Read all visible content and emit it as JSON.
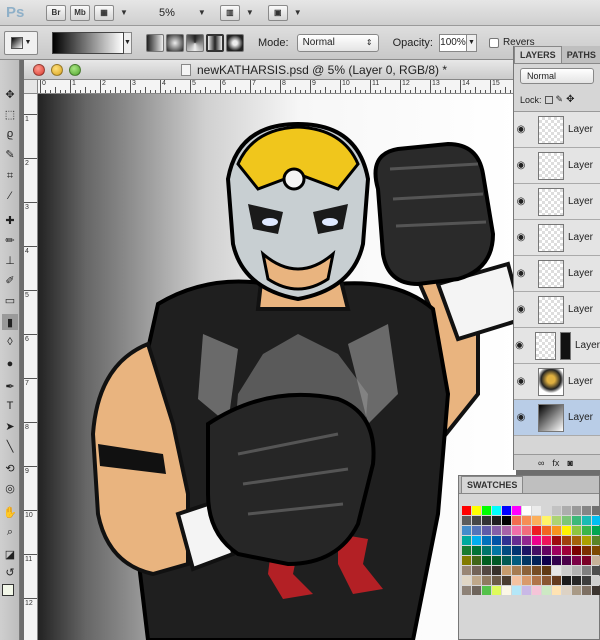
{
  "app": {
    "logo": "Ps",
    "bridge_label": "Br",
    "minibridge_label": "Mb",
    "zoom": "5%",
    "icons": [
      "view-extras-icon",
      "arrange-documents-icon",
      "screen-mode-icon"
    ]
  },
  "options": {
    "mode_label": "Mode:",
    "mode_value": "Normal",
    "opacity_label": "Opacity:",
    "opacity_value": "100%",
    "reverse_label": "Revers"
  },
  "document": {
    "title": "newKATHARSIS.psd @ 5% (Layer 0, RGB/8) *",
    "ruler_h": [
      "0",
      "1",
      "2",
      "3",
      "4",
      "5",
      "6",
      "7",
      "8",
      "9",
      "10",
      "11",
      "12",
      "13",
      "14",
      "15"
    ],
    "ruler_v": [
      "1",
      "2",
      "3",
      "4",
      "5",
      "6",
      "7",
      "8",
      "9",
      "10",
      "11",
      "12"
    ]
  },
  "layers_panel": {
    "tab_layers": "LAYERS",
    "tab_paths": "PATHS",
    "blend_mode": "Normal",
    "lock_label": "Lock:",
    "layers": [
      {
        "name": "Layer",
        "thumb": "transparent",
        "selected": false
      },
      {
        "name": "Layer",
        "thumb": "transparent",
        "selected": false
      },
      {
        "name": "Layer",
        "thumb": "transparent",
        "selected": false
      },
      {
        "name": "Layer",
        "thumb": "transparent",
        "selected": false
      },
      {
        "name": "Layer",
        "thumb": "transparent",
        "selected": false
      },
      {
        "name": "Layer",
        "thumb": "transparent",
        "selected": false
      },
      {
        "name": "Layer",
        "thumb": "mask",
        "selected": false
      },
      {
        "name": "Layer",
        "thumb": "art",
        "selected": false
      },
      {
        "name": "Layer",
        "thumb": "gradient",
        "selected": true
      }
    ],
    "footer_fx": "fx"
  },
  "swatches_panel": {
    "tab": "SWATCHES",
    "colors": [
      "#ff0000",
      "#ffff00",
      "#00ff00",
      "#00ffff",
      "#0000ff",
      "#ff00ff",
      "#ffffff",
      "#ebebeb",
      "#d6d6d6",
      "#c2c2c2",
      "#adadad",
      "#999999",
      "#858585",
      "#707070",
      "#5c5c5c",
      "#474747",
      "#333333",
      "#1f1f1f",
      "#000000",
      "#f26c4f",
      "#f68e55",
      "#fbaf5c",
      "#fff467",
      "#acd372",
      "#7cc576",
      "#3bb878",
      "#1abbb4",
      "#00bff3",
      "#438ccb",
      "#5574b9",
      "#605ca8",
      "#855fa8",
      "#a763a8",
      "#f06ea9",
      "#f26d7d",
      "#ed1c24",
      "#f26522",
      "#f7941d",
      "#fff200",
      "#8dc63f",
      "#39b54a",
      "#00a651",
      "#00a99d",
      "#00aeef",
      "#0072bc",
      "#0054a6",
      "#2e3192",
      "#662d91",
      "#92278f",
      "#ec008c",
      "#ed145b",
      "#9e0b0f",
      "#a0410d",
      "#a36209",
      "#aba000",
      "#598527",
      "#1a7b30",
      "#007236",
      "#00746b",
      "#0076a3",
      "#004b80",
      "#003471",
      "#1b1464",
      "#440e62",
      "#630460",
      "#9e005d",
      "#9e0039",
      "#790000",
      "#7b2e00",
      "#7d4900",
      "#827b00",
      "#406618",
      "#005e20",
      "#005826",
      "#005952",
      "#005b7f",
      "#003663",
      "#002157",
      "#0d004c",
      "#32004b",
      "#4b0049",
      "#7b0046",
      "#7a0026",
      "#c7b299",
      "#998675",
      "#736357",
      "#534741",
      "#37302a",
      "#c69c6d",
      "#a67c52",
      "#8c6239",
      "#754c24",
      "#603913",
      "#e6e6e6",
      "#cccccc",
      "#b3b3b3",
      "#808080",
      "#4d4d4d",
      "#e0d6c5",
      "#bfa88a",
      "#8f7a60",
      "#6b5a46",
      "#4a3d2f",
      "#f4c2a1",
      "#d99a6c",
      "#b0744a",
      "#8a5631",
      "#633a1e",
      "#1a1a1a",
      "#262626",
      "#3d3d3d",
      "#cfcfcf",
      "#8e8277",
      "#6f655c",
      "#55c24b",
      "#dffb5c",
      "#fbf7e6",
      "#b4e7f8",
      "#c9b8e6",
      "#f5c4d8",
      "#cde9c4",
      "#ffe3b3",
      "#ddd2c4",
      "#a99a86",
      "#7e7063",
      "#3c3530"
    ]
  }
}
